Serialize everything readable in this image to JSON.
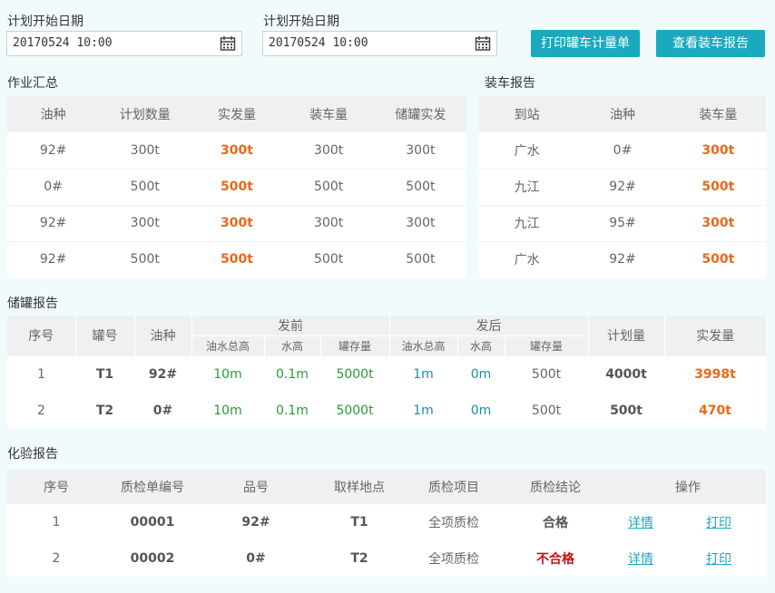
{
  "filters": {
    "start_label": "计划开始日期",
    "start_value": "20170524  10:00",
    "end_label": "计划开始日期",
    "end_value": "20170524  10:00",
    "print_button": "打印罐车计量单",
    "report_button": "查看装车报告"
  },
  "summary": {
    "title": "作业汇总",
    "headers": [
      "油种",
      "计划数量",
      "实发量",
      "装车量",
      "储罐实发"
    ],
    "rows": [
      [
        "92#",
        "300t",
        "300t",
        "300t",
        "300t"
      ],
      [
        "0#",
        "500t",
        "500t",
        "500t",
        "500t"
      ],
      [
        "92#",
        "300t",
        "300t",
        "300t",
        "300t"
      ],
      [
        "92#",
        "500t",
        "500t",
        "500t",
        "500t"
      ]
    ]
  },
  "loading": {
    "title": "装车报告",
    "headers": [
      "到站",
      "油种",
      "装车量"
    ],
    "rows": [
      [
        "广水",
        "0#",
        "300t"
      ],
      [
        "九江",
        "92#",
        "500t"
      ],
      [
        "九江",
        "95#",
        "300t"
      ],
      [
        "广水",
        "92#",
        "500t"
      ]
    ]
  },
  "tank": {
    "title": "储罐报告",
    "headers": {
      "seq": "序号",
      "tank": "罐号",
      "oil": "油种",
      "before": "发前",
      "after": "发后",
      "sub": [
        "油水总高",
        "水高",
        "罐存量",
        "油水总高",
        "水高",
        "罐存量"
      ],
      "plan": "计划量",
      "actual": "实发量"
    },
    "rows": [
      [
        "1",
        "T1",
        "92#",
        "10m",
        "0.1m",
        "5000t",
        "1m",
        "0m",
        "500t",
        "4000t",
        "3998t"
      ],
      [
        "2",
        "T2",
        "0#",
        "10m",
        "0.1m",
        "5000t",
        "1m",
        "0m",
        "500t",
        "500t",
        "470t"
      ]
    ]
  },
  "lab": {
    "title": "化验报告",
    "headers": [
      "序号",
      "质检单编号",
      "品号",
      "取样地点",
      "质检项目",
      "质检结论",
      "操作"
    ],
    "rows": [
      [
        "1",
        "00001",
        "92#",
        "T1",
        "全项质检",
        "合格",
        "详情",
        "打印"
      ],
      [
        "2",
        "00002",
        "0#",
        "T2",
        "全项质检",
        "不合格",
        "详情",
        "打印"
      ]
    ]
  },
  "colors": {
    "accent": "#1aa9be",
    "highlight": "#e8691c",
    "fail": "#c31212"
  }
}
